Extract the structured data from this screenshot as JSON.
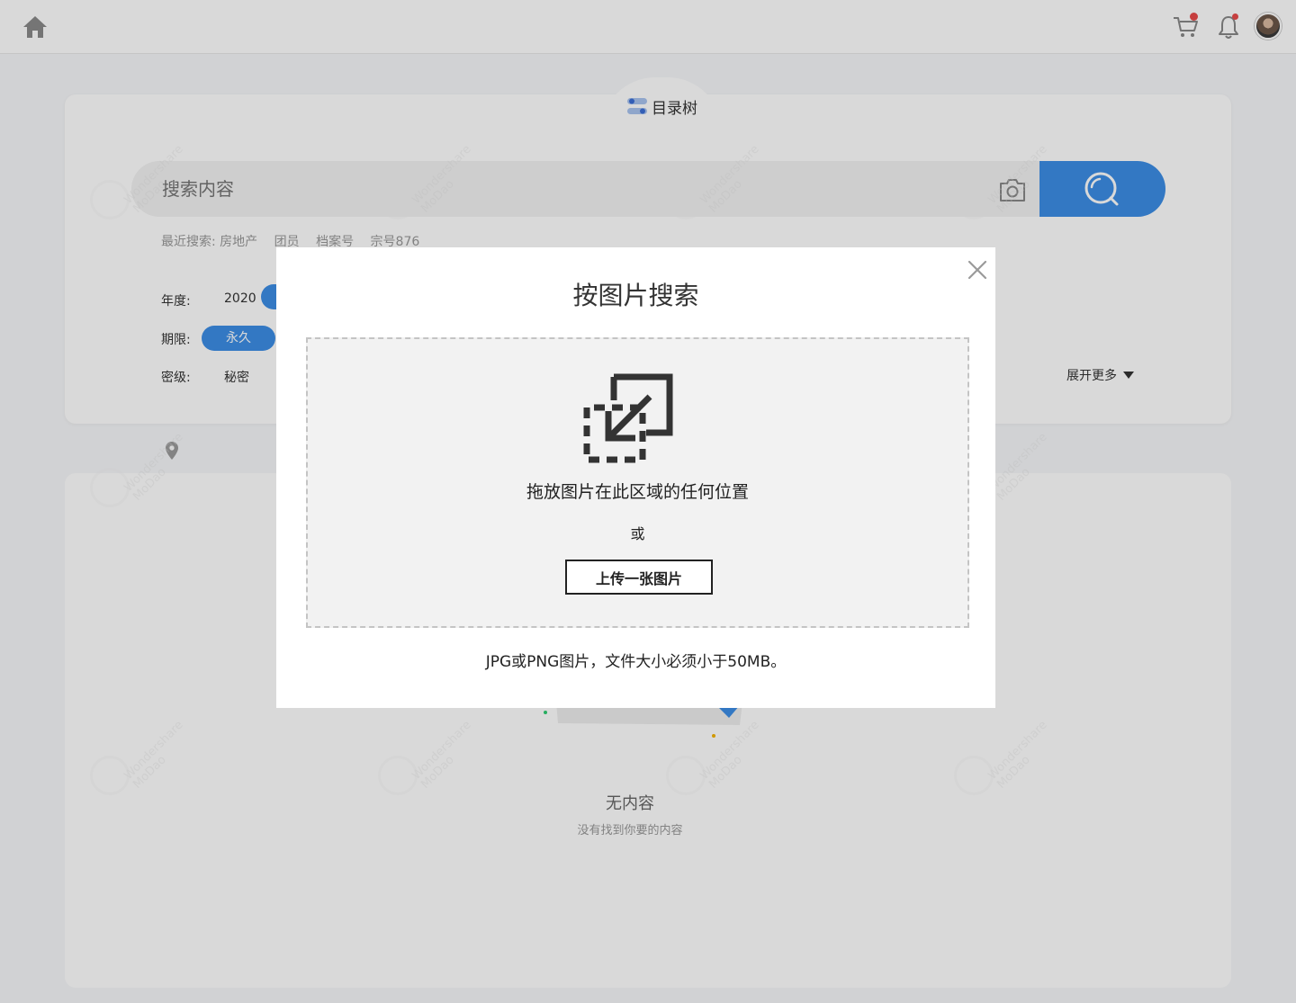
{
  "topbar": {
    "home_icon": "home-icon",
    "cart_icon": "cart-icon",
    "bell_icon": "bell-icon",
    "badge_color": "#e94b4b"
  },
  "catalog_tree": {
    "label": "目录树",
    "icon": "toggle-list-icon"
  },
  "search": {
    "placeholder": "搜索内容",
    "camera_icon": "camera-icon",
    "search_icon": "search-icon",
    "accent_color": "#3d8ee6"
  },
  "recent": {
    "title": "最近搜索:",
    "items": [
      "房地产",
      "团员",
      "档案号",
      "宗号876"
    ]
  },
  "filters": {
    "year_label": "年度:",
    "year_value": "2020",
    "term_label": "期限:",
    "term_value": "永久",
    "secret_label": "密级:",
    "secret_value": "秘密",
    "expand_more": "展开更多"
  },
  "results": {
    "empty_title": "无内容",
    "empty_subtitle": "没有找到你要的内容"
  },
  "watermark": {
    "line1": "Wondershare",
    "line2": "MoDao"
  },
  "modal": {
    "title": "按图片搜索",
    "drop_text": "拖放图片在此区域的任何位置",
    "or_text": "或",
    "upload_button": "上传一张图片",
    "hint": "JPG或PNG图片，文件大小必须小于50MB。",
    "close_icon": "close-icon"
  }
}
